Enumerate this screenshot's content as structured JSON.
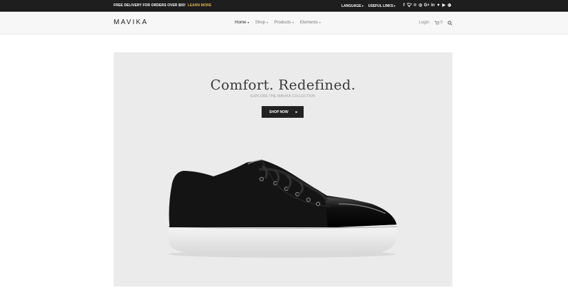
{
  "topbar": {
    "promo_text": "FREE DELIVERY FOR ORDERS OVER $50!",
    "promo_link": "LEARN MORE",
    "promo_link_color": "#e8b64b",
    "language_label": "LANGUAGE",
    "useful_links_label": "USEFUL LINKS",
    "social_icons": [
      "facebook-icon",
      "twitter-icon",
      "pinterest-icon",
      "instagram-icon",
      "google-plus-icon",
      "linkedin-icon",
      "heart-icon",
      "youtube-icon",
      "dribbble-icon"
    ]
  },
  "header": {
    "logo": "MAVIKA",
    "nav": [
      {
        "label": "Home"
      },
      {
        "label": "Shop"
      },
      {
        "label": "Products"
      },
      {
        "label": "Elements"
      }
    ],
    "login_label": "Login",
    "cart_count": "0"
  },
  "hero": {
    "title": "Comfort. Redefined.",
    "subtitle": "EXPLORE THE MAVIKA COLLECTION",
    "button_label": "SHOP NOW",
    "background": "#ebebeb"
  }
}
